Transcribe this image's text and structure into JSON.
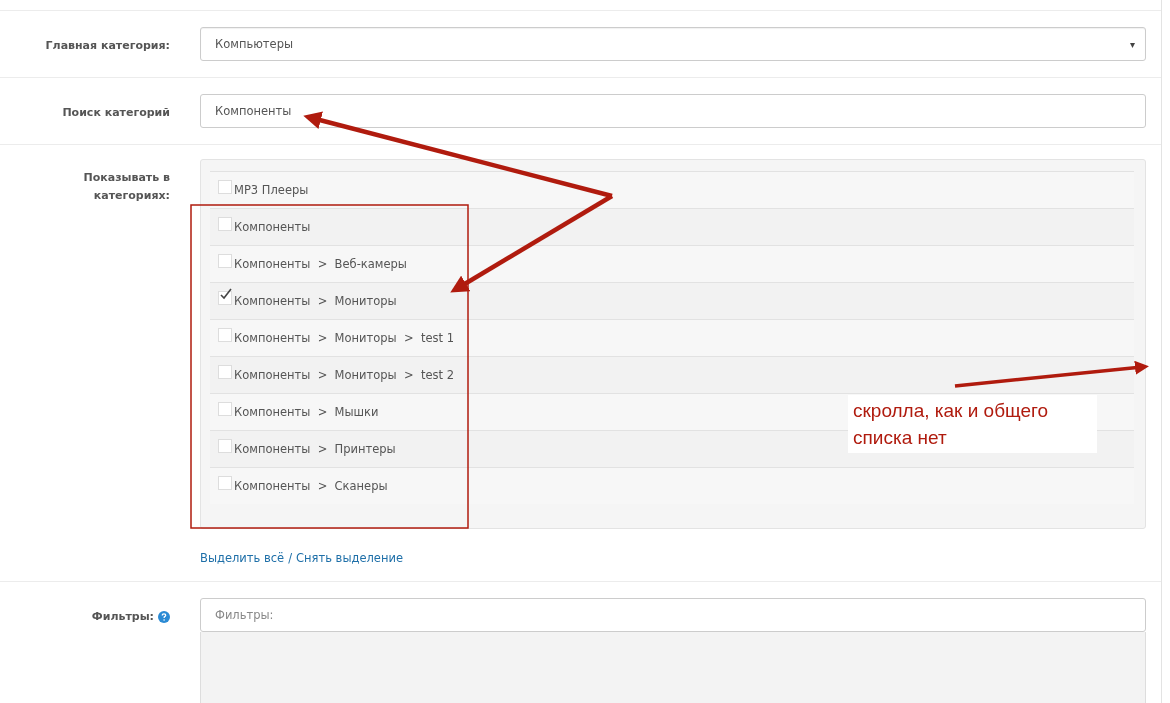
{
  "main_category": {
    "label": "Главная категория:",
    "value": "Компьютеры",
    "arrow": "▾"
  },
  "category_search": {
    "label": "Поиск категорий",
    "value": "Компоненты"
  },
  "show_in_categories": {
    "label": "Показывать в категориях:",
    "items": [
      {
        "label": "MP3 Плееры",
        "checked": false
      },
      {
        "label": "Компоненты",
        "checked": false
      },
      {
        "label": "Компоненты  >  Веб-камеры",
        "checked": false
      },
      {
        "label": "Компоненты  >  Мониторы",
        "checked": true
      },
      {
        "label": "Компоненты  >  Мониторы  >  test 1",
        "checked": false
      },
      {
        "label": "Компоненты  >  Мониторы  >  test 2",
        "checked": false
      },
      {
        "label": "Компоненты  >  Мышки",
        "checked": false
      },
      {
        "label": "Компоненты  >  Принтеры",
        "checked": false
      },
      {
        "label": "Компоненты  >  Сканеры",
        "checked": false
      }
    ],
    "select_all": "Выделить всё",
    "separator": "/",
    "deselect": "Снять выделение"
  },
  "filters": {
    "label": "Фильтры:",
    "placeholder": "Фильтры:"
  },
  "annotation": {
    "note": "скролла, как и общего списка нет"
  }
}
